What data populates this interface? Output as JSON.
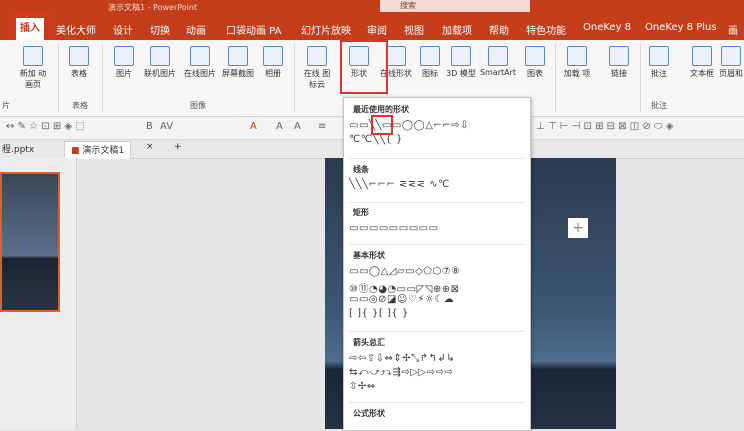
{
  "window": {
    "title": "演示文稿1 - PowerPoint",
    "search_placeholder": "搜索"
  },
  "tabs": [
    "插入",
    "美化大师",
    "设计",
    "切换",
    "动画",
    "口袋动画 PA",
    "幻灯片放映",
    "审阅",
    "视图",
    "加载项",
    "帮助",
    "特色功能",
    "OneKey 8",
    "OneKey 8 Plus",
    "画"
  ],
  "ribbon": {
    "left_items": [
      "新加 动画页",
      "表格",
      "图片",
      "联机图片",
      "在线图片",
      "屏幕截图",
      "相册",
      "在线 图标云"
    ],
    "items": [
      "形状",
      "在线形状",
      "图标",
      "3D 模型",
      "SmartArt",
      "图表",
      "加载 项",
      "链接",
      "批注",
      "文本框",
      "页眉和"
    ],
    "groups": [
      "片",
      "表格",
      "图像",
      "批注"
    ]
  },
  "fmt_bar": [
    "A",
    "A",
    "A",
    "≡",
    "B",
    "AV",
    "A"
  ],
  "doc_tabs": {
    "file": "程.pptx",
    "active": "演示文稿1",
    "close": "×",
    "add": "+"
  },
  "shapes_menu": {
    "sections": [
      {
        "title": "最近使用的形状",
        "rows": [
          "▭▭╲╲▭▭◯◯△⌐⌐⇨⇩",
          "℃℃╲╲{ }"
        ]
      },
      {
        "title": "线条",
        "rows": [
          "╲╲╲⌐⌐⌐ ⋜⋜⋜ ∿℃"
        ]
      },
      {
        "title": "矩形",
        "rows": [
          "▭▭▭▭▭▭▭▭▭"
        ]
      },
      {
        "title": "基本形状",
        "rows": [
          "▭▭◯△◿▱▭◇⬠⬡⑦⑧",
          "⑩⑪◔◕◔▭▭◸◹⊕⊕⊠",
          "▭▭◎⊘◪☺♡⚡☼☾☁",
          "[ ]{ }[ ]{ }"
        ]
      },
      {
        "title": "箭头总汇",
        "rows": [
          "⇨⇦⇧⇩⇔⇕✢⤡↱↰↲↳",
          "⇆⤺⤻⤴⤵⇶⇨▷▷⇨⇨⇨",
          "⇳✢⇔"
        ]
      },
      {
        "title": "公式形状",
        "rows": []
      }
    ]
  }
}
